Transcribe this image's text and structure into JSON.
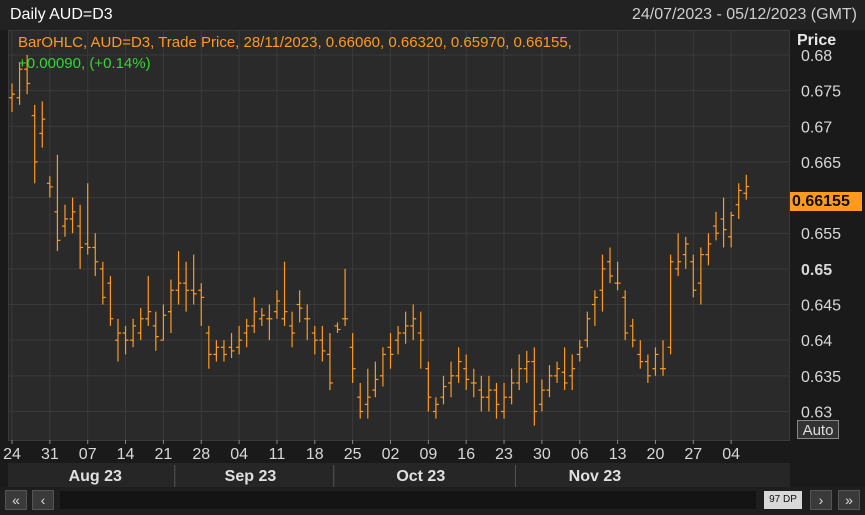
{
  "header": {
    "title": "Daily AUD=D3",
    "date_range": "24/07/2023 - 05/12/2023 (GMT)"
  },
  "info": {
    "line1": "BarOHLC, AUD=D3, Trade Price, 28/11/2023, 0.66060, 0.66320, 0.65970, 0.66155,",
    "line2": "+0.00090, (+0.14%)"
  },
  "price_axis": {
    "header": "Price",
    "last_price": "0.66155",
    "auto_label": "Auto",
    "tick_labels": [
      "0.68",
      "0.675",
      "0.67",
      "0.665",
      "0.66",
      "0.655",
      "0.65",
      "0.645",
      "0.64",
      "0.635",
      "0.63"
    ]
  },
  "scrollbar": {
    "first_label": "«",
    "prev_label": "‹",
    "thumb_label": "97 DP",
    "next_label": "›",
    "last_label": "»"
  },
  "colors": {
    "bar": "#ff9a1f",
    "change_positive": "#33d633",
    "grid": "#3a3a3a",
    "background": "#2a2a2a"
  },
  "chart_data": {
    "type": "bar",
    "subtype": "ohlc",
    "ylim": [
      0.626,
      0.6835
    ],
    "grid": true,
    "day_tick_labels": [
      "24",
      "31",
      "07",
      "14",
      "21",
      "28",
      "04",
      "11",
      "18",
      "25",
      "02",
      "09",
      "16",
      "23",
      "30",
      "06",
      "13",
      "20",
      "27",
      "04"
    ],
    "month_labels": [
      "Aug 23",
      "Sep 23",
      "Oct 23",
      "Nov 23"
    ],
    "series": [
      {
        "name": "AUD=D3",
        "ohlc": [
          [
            0.674,
            0.676,
            0.672,
            0.6745
          ],
          [
            0.674,
            0.679,
            0.673,
            0.678
          ],
          [
            0.678,
            0.68,
            0.6745,
            0.676
          ],
          [
            0.6715,
            0.673,
            0.662,
            0.665
          ],
          [
            0.669,
            0.6735,
            0.667,
            0.671
          ],
          [
            0.662,
            0.663,
            0.66,
            0.6615
          ],
          [
            0.658,
            0.666,
            0.6525,
            0.654
          ],
          [
            0.656,
            0.659,
            0.6545,
            0.657
          ],
          [
            0.657,
            0.66,
            0.655,
            0.658
          ],
          [
            0.656,
            0.659,
            0.65,
            0.653
          ],
          [
            0.6535,
            0.662,
            0.652,
            0.653
          ],
          [
            0.653,
            0.655,
            0.649,
            0.651
          ],
          [
            0.65,
            0.651,
            0.645,
            0.646
          ],
          [
            0.648,
            0.649,
            0.642,
            0.643
          ],
          [
            0.64,
            0.643,
            0.637,
            0.641
          ],
          [
            0.641,
            0.642,
            0.638,
            0.64
          ],
          [
            0.64,
            0.643,
            0.639,
            0.642
          ],
          [
            0.641,
            0.6445,
            0.64,
            0.643
          ],
          [
            0.643,
            0.649,
            0.642,
            0.644
          ],
          [
            0.642,
            0.644,
            0.6385,
            0.6405
          ],
          [
            0.64,
            0.645,
            0.64,
            0.6435
          ],
          [
            0.644,
            0.6485,
            0.641,
            0.647
          ],
          [
            0.647,
            0.6525,
            0.645,
            0.648
          ],
          [
            0.648,
            0.651,
            0.644,
            0.647
          ],
          [
            0.647,
            0.652,
            0.645,
            0.6465
          ],
          [
            0.647,
            0.648,
            0.642,
            0.646
          ],
          [
            0.641,
            0.642,
            0.636,
            0.638
          ],
          [
            0.638,
            0.64,
            0.637,
            0.639
          ],
          [
            0.639,
            0.64,
            0.637,
            0.638
          ],
          [
            0.639,
            0.641,
            0.6375,
            0.6385
          ],
          [
            0.639,
            0.642,
            0.638,
            0.64
          ],
          [
            0.641,
            0.643,
            0.639,
            0.642
          ],
          [
            0.642,
            0.646,
            0.641,
            0.644
          ],
          [
            0.643,
            0.6445,
            0.642,
            0.6435
          ],
          [
            0.643,
            0.645,
            0.64,
            0.643
          ],
          [
            0.644,
            0.647,
            0.643,
            0.6455
          ],
          [
            0.643,
            0.651,
            0.642,
            0.644
          ],
          [
            0.642,
            0.644,
            0.639,
            0.641
          ],
          [
            0.645,
            0.647,
            0.6425,
            0.6445
          ],
          [
            0.643,
            0.645,
            0.64,
            0.643
          ],
          [
            0.641,
            0.642,
            0.638,
            0.64
          ],
          [
            0.64,
            0.642,
            0.637,
            0.6385
          ],
          [
            0.638,
            0.641,
            0.633,
            0.634
          ],
          [
            0.642,
            0.6425,
            0.641,
            0.6415
          ],
          [
            0.643,
            0.65,
            0.642,
            0.643
          ],
          [
            0.639,
            0.641,
            0.634,
            0.636
          ],
          [
            0.632,
            0.634,
            0.629,
            0.63
          ],
          [
            0.631,
            0.636,
            0.629,
            0.632
          ],
          [
            0.633,
            0.637,
            0.632,
            0.6345
          ],
          [
            0.635,
            0.639,
            0.6335,
            0.638
          ],
          [
            0.639,
            0.641,
            0.636,
            0.638
          ],
          [
            0.64,
            0.642,
            0.638,
            0.641
          ],
          [
            0.641,
            0.644,
            0.6395,
            0.642
          ],
          [
            0.642,
            0.645,
            0.64,
            0.643
          ],
          [
            0.641,
            0.644,
            0.636,
            0.64
          ],
          [
            0.636,
            0.637,
            0.63,
            0.632
          ],
          [
            0.63,
            0.632,
            0.629,
            0.631
          ],
          [
            0.632,
            0.635,
            0.631,
            0.6335
          ],
          [
            0.634,
            0.637,
            0.632,
            0.635
          ],
          [
            0.635,
            0.639,
            0.634,
            0.637
          ],
          [
            0.636,
            0.638,
            0.633,
            0.6345
          ],
          [
            0.634,
            0.636,
            0.632,
            0.634
          ],
          [
            0.633,
            0.635,
            0.63,
            0.632
          ],
          [
            0.632,
            0.635,
            0.63,
            0.633
          ],
          [
            0.633,
            0.634,
            0.629,
            0.631
          ],
          [
            0.63,
            0.634,
            0.629,
            0.632
          ],
          [
            0.632,
            0.636,
            0.631,
            0.634
          ],
          [
            0.634,
            0.638,
            0.633,
            0.636
          ],
          [
            0.636,
            0.6385,
            0.634,
            0.637
          ],
          [
            0.637,
            0.639,
            0.628,
            0.63
          ],
          [
            0.631,
            0.6345,
            0.63,
            0.633
          ],
          [
            0.633,
            0.6365,
            0.632,
            0.635
          ],
          [
            0.635,
            0.637,
            0.634,
            0.636
          ],
          [
            0.6355,
            0.639,
            0.633,
            0.634
          ],
          [
            0.635,
            0.638,
            0.633,
            0.636
          ],
          [
            0.638,
            0.64,
            0.637,
            0.639
          ],
          [
            0.64,
            0.644,
            0.639,
            0.643
          ],
          [
            0.645,
            0.647,
            0.642,
            0.646
          ],
          [
            0.647,
            0.652,
            0.644,
            0.65
          ],
          [
            0.651,
            0.653,
            0.648,
            0.649
          ],
          [
            0.648,
            0.651,
            0.647,
            0.648
          ],
          [
            0.646,
            0.647,
            0.64,
            0.641
          ],
          [
            0.642,
            0.643,
            0.639,
            0.64
          ],
          [
            0.638,
            0.64,
            0.636,
            0.637
          ],
          [
            0.637,
            0.638,
            0.634,
            0.635
          ],
          [
            0.636,
            0.639,
            0.635,
            0.638
          ],
          [
            0.636,
            0.64,
            0.635,
            0.636
          ],
          [
            0.639,
            0.652,
            0.638,
            0.651
          ],
          [
            0.65,
            0.655,
            0.649,
            0.651
          ],
          [
            0.652,
            0.6545,
            0.65,
            0.6535
          ],
          [
            0.651,
            0.652,
            0.646,
            0.647
          ],
          [
            0.648,
            0.653,
            0.645,
            0.652
          ],
          [
            0.652,
            0.655,
            0.6505,
            0.6535
          ],
          [
            0.656,
            0.658,
            0.654,
            0.655
          ],
          [
            0.657,
            0.66,
            0.653,
            0.6555
          ],
          [
            0.6545,
            0.658,
            0.653,
            0.6575
          ],
          [
            0.659,
            0.662,
            0.657,
            0.661
          ],
          [
            0.6606,
            0.6632,
            0.6597,
            0.66155
          ]
        ]
      }
    ]
  }
}
